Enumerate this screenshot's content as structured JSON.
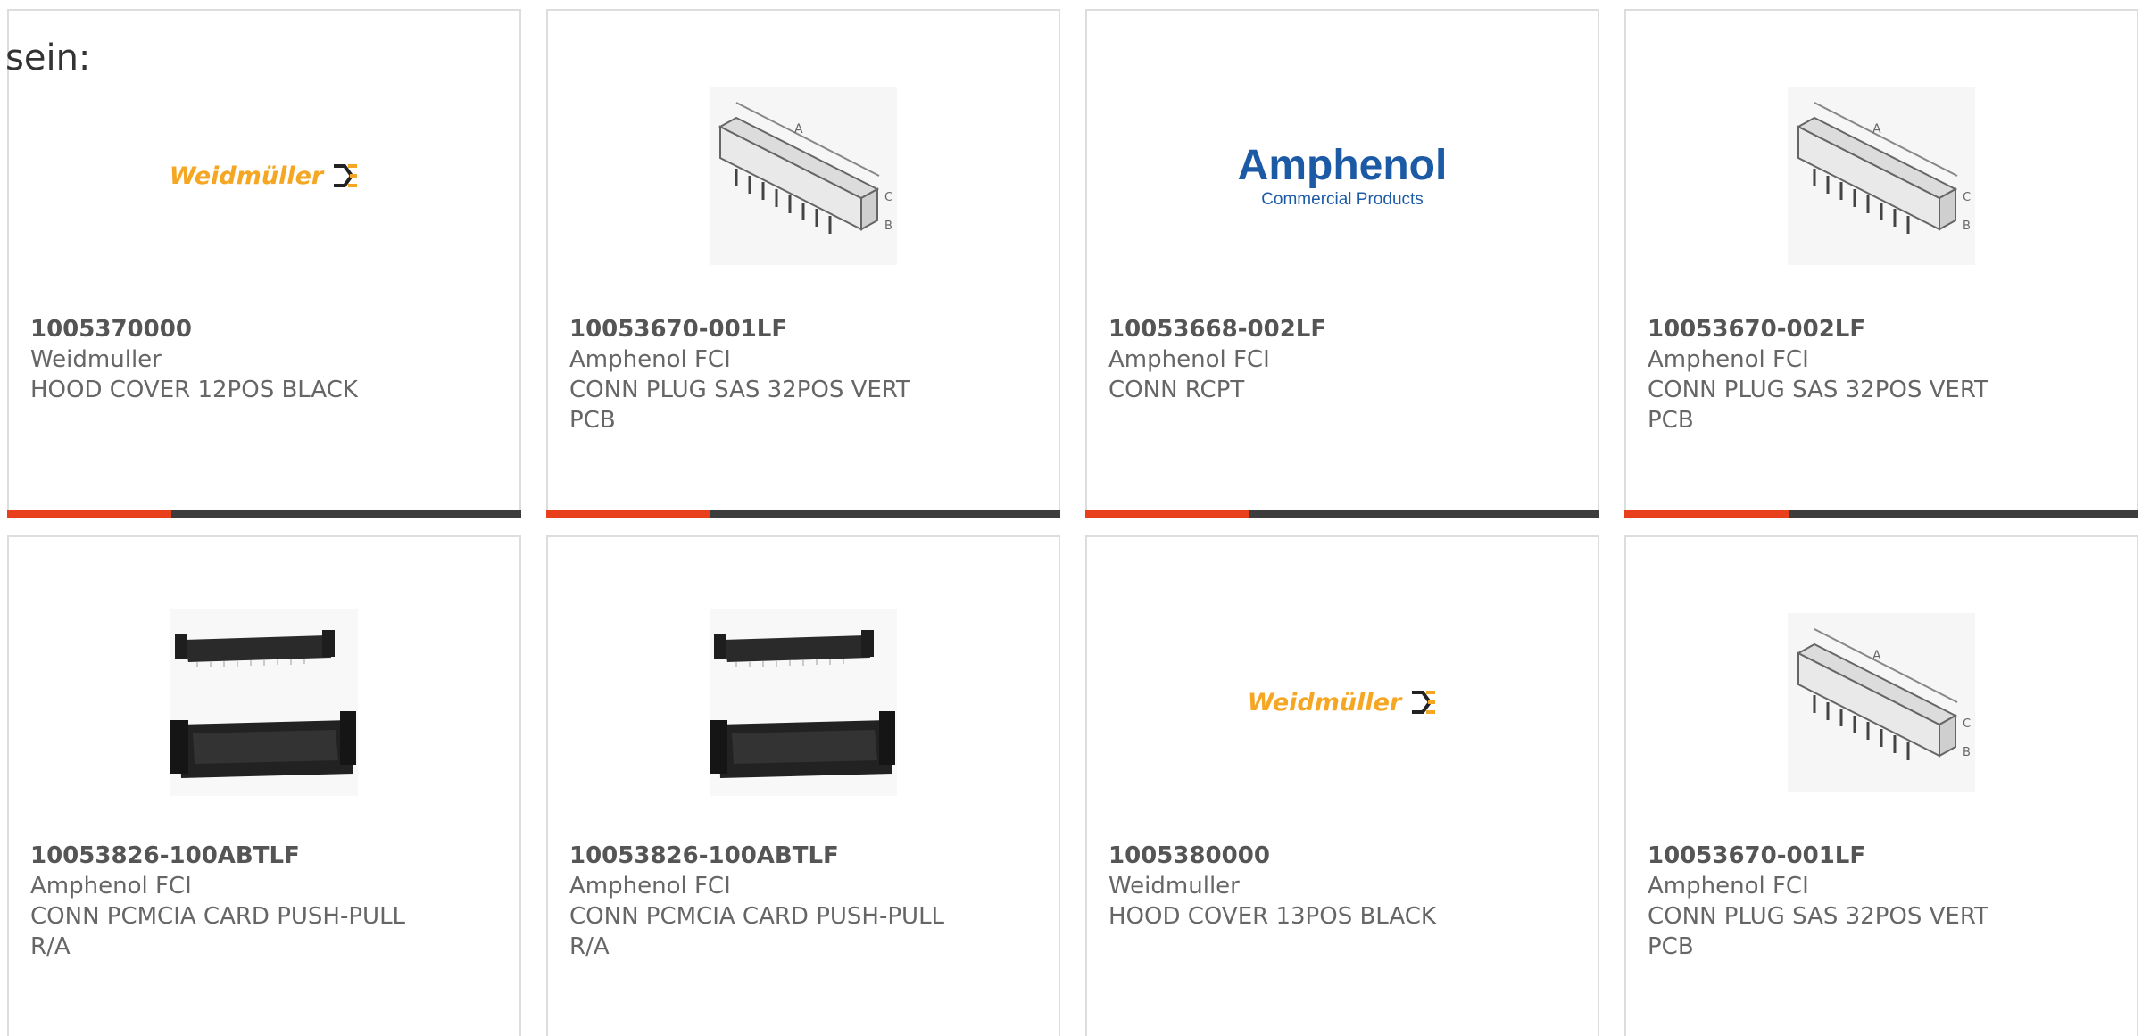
{
  "lead_text": "sein:",
  "colors": {
    "accent": "#e8401c",
    "bar": "#3c3c3c",
    "weidmuller": "#f5a623",
    "amphenol": "#1d5aa6"
  },
  "products": [
    {
      "part_no": "1005370000",
      "manufacturer": "Weidmuller",
      "description": "HOOD COVER 12POS BLACK",
      "image": "weidmuller-logo",
      "logo_text": "Weidmüller"
    },
    {
      "part_no": "10053670-001LF",
      "manufacturer": "Amphenol FCI",
      "description": "CONN PLUG SAS 32POS VERT PCB",
      "image": "sas-connector-drawing"
    },
    {
      "part_no": "10053668-002LF",
      "manufacturer": "Amphenol FCI",
      "description": "CONN RCPT",
      "image": "amphenol-logo",
      "logo_text": "Amphenol",
      "logo_sub": "Commercial Products"
    },
    {
      "part_no": "10053670-002LF",
      "manufacturer": "Amphenol FCI",
      "description": "CONN PLUG SAS 32POS VERT PCB",
      "image": "sas-connector-drawing"
    },
    {
      "part_no": "10053826-100ABTLF",
      "manufacturer": "Amphenol FCI",
      "description": "CONN PCMCIA CARD PUSH-PULL R/A",
      "image": "pcmcia-connector-photo"
    },
    {
      "part_no": "10053826-100ABTLF",
      "manufacturer": "Amphenol FCI",
      "description": "CONN PCMCIA CARD PUSH-PULL R/A",
      "image": "pcmcia-connector-photo"
    },
    {
      "part_no": "1005380000",
      "manufacturer": "Weidmuller",
      "description": "HOOD COVER 13POS BLACK",
      "image": "weidmuller-logo",
      "logo_text": "Weidmüller"
    },
    {
      "part_no": "10053670-001LF",
      "manufacturer": "Amphenol FCI",
      "description": "CONN PLUG SAS 32POS VERT PCB",
      "image": "sas-connector-drawing"
    }
  ]
}
